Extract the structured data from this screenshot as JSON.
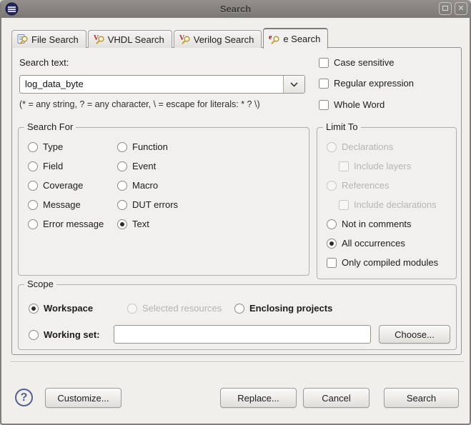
{
  "window": {
    "title": "Search"
  },
  "titlebar": {
    "app_icon": "eclipse-logo",
    "maximize": "maximize-button",
    "close": "close-button"
  },
  "tabs": [
    {
      "label": "File Search",
      "icon": "file-search-icon",
      "active": false
    },
    {
      "label": "VHDL Search",
      "icon": "vhdl-search-icon",
      "active": false
    },
    {
      "label": "Verilog Search",
      "icon": "verilog-search-icon",
      "active": false
    },
    {
      "label": "e Search",
      "icon": "e-search-icon",
      "active": true
    }
  ],
  "search_section": {
    "label": "Search text:",
    "value": "log_data_byte",
    "hint": "(* = any string, ? = any character, \\ = escape for literals: * ? \\)"
  },
  "options": [
    {
      "label": "Case sensitive",
      "checked": false
    },
    {
      "label": "Regular expression",
      "checked": false
    },
    {
      "label": "Whole Word",
      "checked": false
    }
  ],
  "search_for": {
    "legend": "Search For",
    "items": [
      {
        "label": "Type",
        "selected": false
      },
      {
        "label": "Field",
        "selected": false
      },
      {
        "label": "Coverage",
        "selected": false
      },
      {
        "label": "Message",
        "selected": false
      },
      {
        "label": "Error message",
        "selected": false
      },
      {
        "label": "Function",
        "selected": false
      },
      {
        "label": "Event",
        "selected": false
      },
      {
        "label": "Macro",
        "selected": false
      },
      {
        "label": "DUT errors",
        "selected": false
      },
      {
        "label": "Text",
        "selected": true
      }
    ]
  },
  "limit_to": {
    "legend": "Limit To",
    "items": [
      {
        "label": "Declarations",
        "type": "radio",
        "disabled": true,
        "selected": false
      },
      {
        "label": "Include layers",
        "type": "checkbox",
        "disabled": true,
        "checked": false
      },
      {
        "label": "References",
        "type": "radio",
        "disabled": true,
        "selected": false
      },
      {
        "label": "Include declarations",
        "type": "checkbox",
        "disabled": true,
        "checked": false
      },
      {
        "label": "Not in comments",
        "type": "radio",
        "disabled": false,
        "selected": false
      },
      {
        "label": "All occurrences",
        "type": "radio",
        "disabled": false,
        "selected": true
      },
      {
        "label": "Only compiled modules",
        "type": "checkbox",
        "disabled": false,
        "checked": false
      }
    ]
  },
  "scope": {
    "legend": "Scope",
    "workspace": {
      "label": "Workspace",
      "selected": true
    },
    "selected_resources": {
      "label": "Selected resources",
      "disabled": true
    },
    "enclosing_projects": {
      "label": "Enclosing projects",
      "selected": false
    },
    "working_set": {
      "label": "Working set:",
      "value": "",
      "selected": false
    },
    "choose_label": "Choose..."
  },
  "footer": {
    "help": "?",
    "customize": "Customize...",
    "replace": "Replace...",
    "cancel": "Cancel",
    "search": "Search"
  },
  "colors": {
    "titlebar": "#86837f",
    "panel_bg": "#f1f0ee",
    "accent_help": "#55618f",
    "disabled_text": "#b7b5b1"
  }
}
